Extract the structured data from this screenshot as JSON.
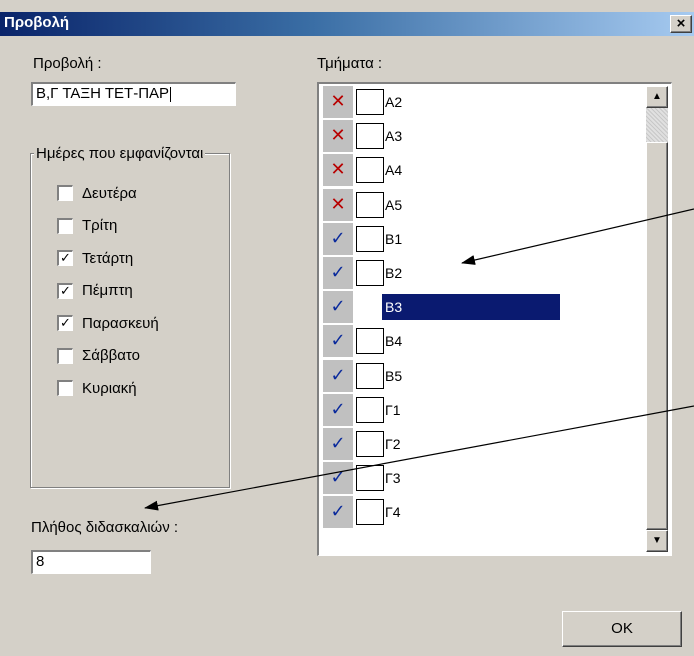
{
  "window": {
    "title": "Προβολή",
    "close_glyph": "×",
    "close_icon": "close-icon"
  },
  "view": {
    "label": "Προβολή :",
    "value": "Β,Γ ΤΑΞΗ ΤΕΤ-ΠΑΡ"
  },
  "days": {
    "legend": "Ημέρες που εμφανίζονται",
    "items": [
      {
        "label": "Δευτέρα",
        "checked": false
      },
      {
        "label": "Τρίτη",
        "checked": false
      },
      {
        "label": "Τετάρτη",
        "checked": true
      },
      {
        "label": "Πέμπτη",
        "checked": true
      },
      {
        "label": "Παρασκευή",
        "checked": true
      },
      {
        "label": "Σάββατο",
        "checked": false
      },
      {
        "label": "Κυριακή",
        "checked": false
      }
    ]
  },
  "teachers": {
    "label": "Πλήθος διδασκαλιών :",
    "value": "8"
  },
  "sections": {
    "label": "Τμήματα :",
    "selected": "Β3",
    "items": [
      {
        "label": "Α2",
        "state": "excluded"
      },
      {
        "label": "Α3",
        "state": "excluded"
      },
      {
        "label": "Α4",
        "state": "excluded"
      },
      {
        "label": "Α5",
        "state": "excluded"
      },
      {
        "label": "Β1",
        "state": "included"
      },
      {
        "label": "Β2",
        "state": "included"
      },
      {
        "label": "Β3",
        "state": "included"
      },
      {
        "label": "Β4",
        "state": "included"
      },
      {
        "label": "Β5",
        "state": "included"
      },
      {
        "label": "Γ1",
        "state": "included"
      },
      {
        "label": "Γ2",
        "state": "included"
      },
      {
        "label": "Γ3",
        "state": "included"
      },
      {
        "label": "Γ4",
        "state": "included"
      }
    ],
    "excluded_glyph": "✕",
    "included_glyph": "✓",
    "excluded_color": "#b80000",
    "included_color": "#0a2a9c"
  },
  "scroll": {
    "up_glyph": "▲",
    "down_glyph": "▼"
  },
  "buttons": {
    "ok": "OK"
  },
  "colors": {
    "titlebar_start": "#0a246a",
    "selection": "#0a1a70",
    "face": "#d4d0c8"
  }
}
